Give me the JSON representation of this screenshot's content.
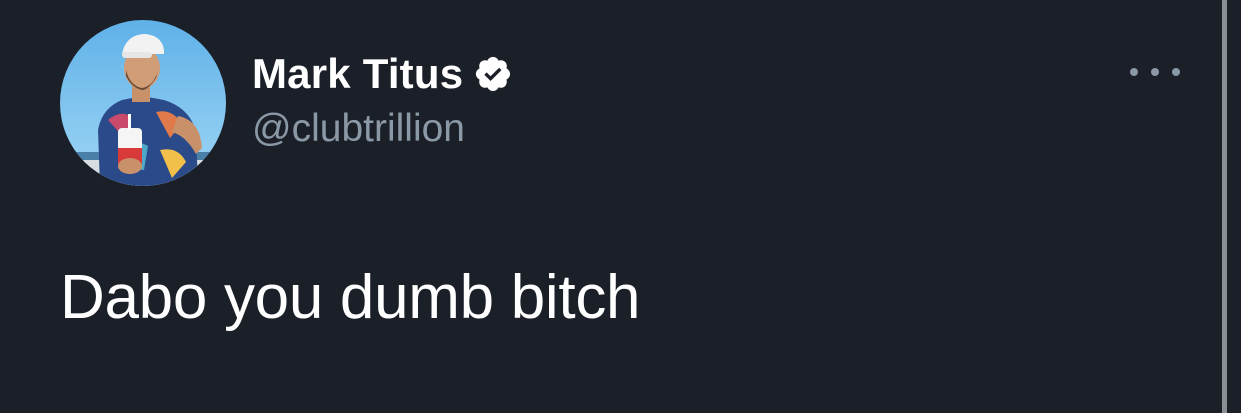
{
  "tweet": {
    "author": {
      "display_name": "Mark Titus",
      "handle": "@clubtrillion",
      "verified": true,
      "avatar_icon": "profile-photo"
    },
    "text": "Dabo you dumb bitch",
    "more_options_icon": "more-horizontal-icon"
  },
  "colors": {
    "background": "#1a1f28",
    "primary_text": "#ffffff",
    "secondary_text": "#8b98a5",
    "scrollbar": "#8a8e95"
  }
}
